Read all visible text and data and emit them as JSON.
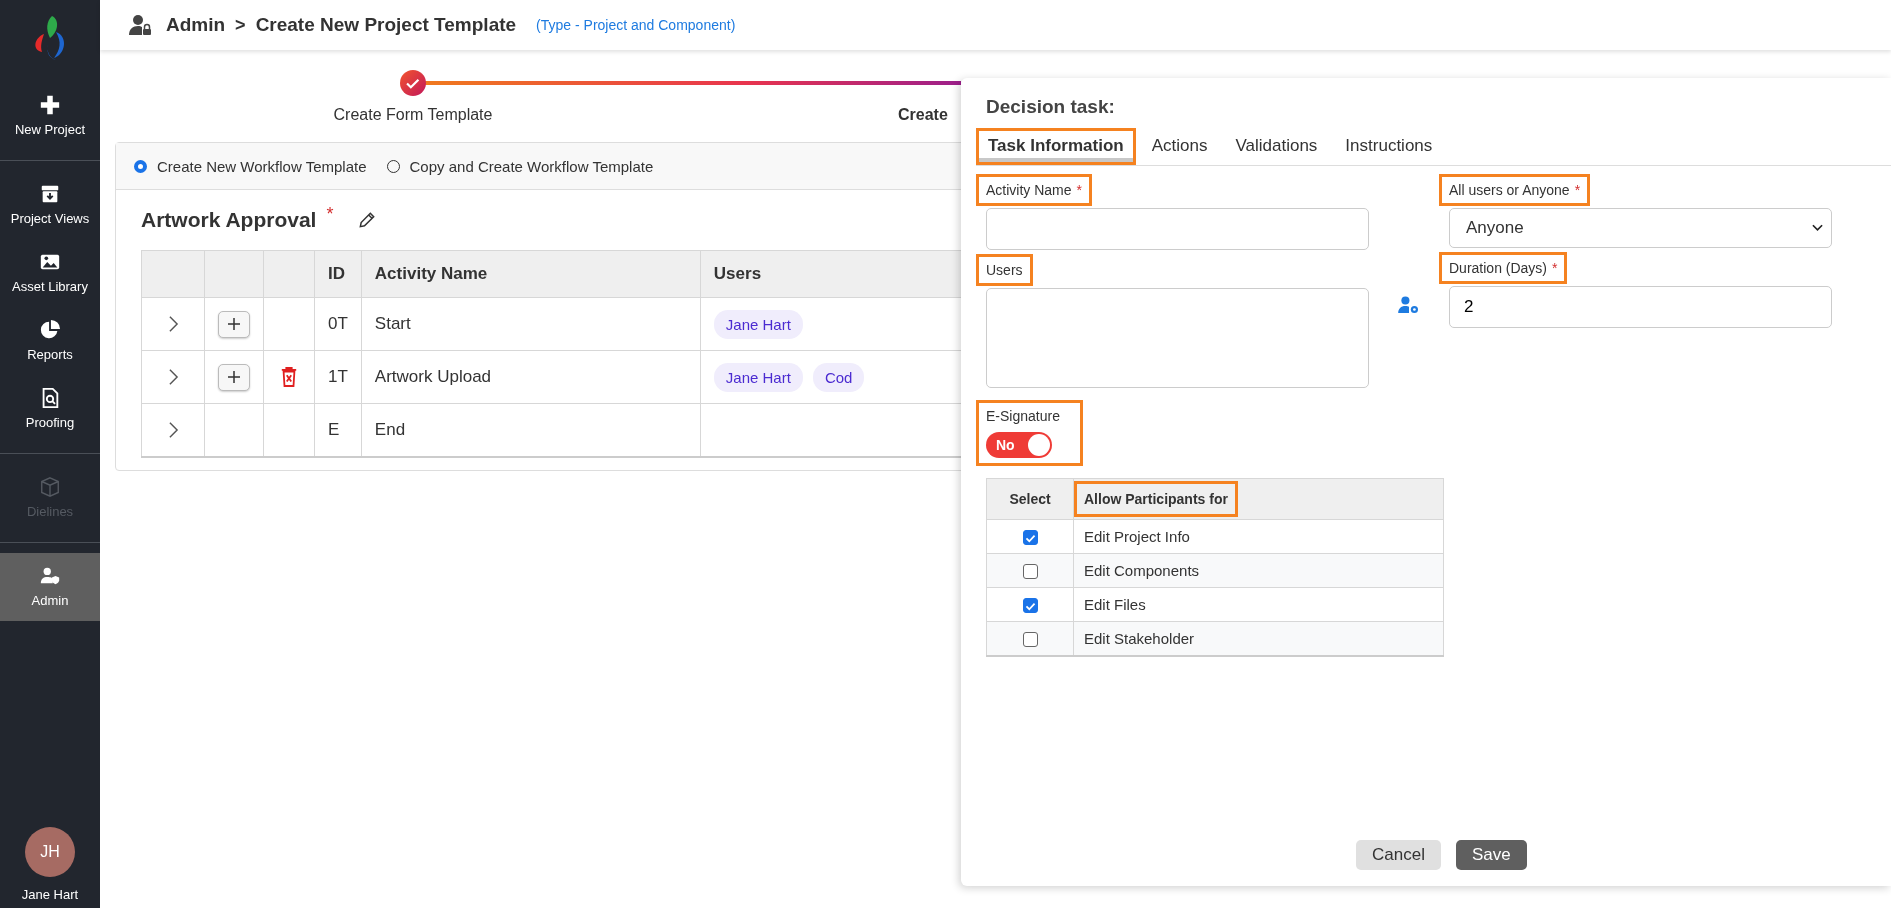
{
  "sidebar": {
    "sections": [
      [
        {
          "label": "New Project",
          "selected": false,
          "disabled": false
        }
      ],
      [
        {
          "label": "Project Views",
          "selected": false,
          "disabled": false
        },
        {
          "label": "Asset Library",
          "selected": false,
          "disabled": false
        },
        {
          "label": "Reports",
          "selected": false,
          "disabled": false
        },
        {
          "label": "Proofing",
          "selected": false,
          "disabled": false
        }
      ],
      [
        {
          "label": "Dielines",
          "selected": false,
          "disabled": true
        }
      ],
      [
        {
          "label": "Admin",
          "selected": true,
          "disabled": false
        }
      ]
    ],
    "user": {
      "initials": "JH",
      "name": "Jane Hart"
    }
  },
  "header": {
    "breadcrumb": [
      "Admin",
      "Create New Project Template"
    ],
    "separator": ">",
    "type_note": "(Type - Project and Component)"
  },
  "stepper": {
    "steps": [
      {
        "label": "Create Form Template",
        "completed": true,
        "current": false
      },
      {
        "label": "Create",
        "completed": false,
        "current": true
      }
    ]
  },
  "workflow": {
    "options": [
      {
        "label": "Create New Workflow Template",
        "selected": true
      },
      {
        "label": "Copy and Create Workflow Template",
        "selected": false
      }
    ],
    "title": "Artwork Approval",
    "required_mark": "*",
    "table": {
      "columns": [
        "ID",
        "Activity Name",
        "Users"
      ],
      "rows": [
        {
          "can_add": true,
          "can_delete": false,
          "id": "0T",
          "name": "Start",
          "users": [
            "Jane Hart"
          ]
        },
        {
          "can_add": true,
          "can_delete": true,
          "id": "1T",
          "name": "Artwork Upload",
          "users": [
            "Jane Hart",
            "Cod"
          ]
        },
        {
          "can_add": false,
          "can_delete": false,
          "id": "E",
          "name": "End",
          "users": []
        }
      ]
    }
  },
  "panel": {
    "title": "Decision task:",
    "tabs": [
      {
        "label": "Task Information",
        "selected": true,
        "highlighted": true
      },
      {
        "label": "Actions",
        "selected": false,
        "highlighted": false
      },
      {
        "label": "Validations",
        "selected": false,
        "highlighted": false
      },
      {
        "label": "Instructions",
        "selected": false,
        "highlighted": false
      }
    ],
    "activity_name": {
      "label": "Activity Name",
      "required_mark": "*",
      "highlighted": true
    },
    "assignment": {
      "label": "All users or Anyone",
      "required_mark": "*",
      "highlighted": true,
      "value": "Anyone"
    },
    "users": {
      "label": "Users",
      "highlighted": true
    },
    "duration": {
      "label": "Duration (Days)",
      "required_mark": "*",
      "highlighted": true,
      "value": "2"
    },
    "e_signature": {
      "label": "E-Signature",
      "highlighted": true,
      "on": false,
      "text": "No"
    },
    "permissions": {
      "columns": [
        {
          "label": "Select",
          "highlighted": false
        },
        {
          "label": "Allow Participants for",
          "highlighted": true
        }
      ],
      "rows": [
        {
          "label": "Edit Project Info",
          "checked": true
        },
        {
          "label": "Edit Components",
          "checked": false
        },
        {
          "label": "Edit Files",
          "checked": true
        },
        {
          "label": "Edit Stakeholder",
          "checked": false
        }
      ]
    },
    "buttons": [
      {
        "label": "Cancel",
        "kind": "secondary"
      },
      {
        "label": "Save",
        "kind": "primary"
      }
    ]
  }
}
